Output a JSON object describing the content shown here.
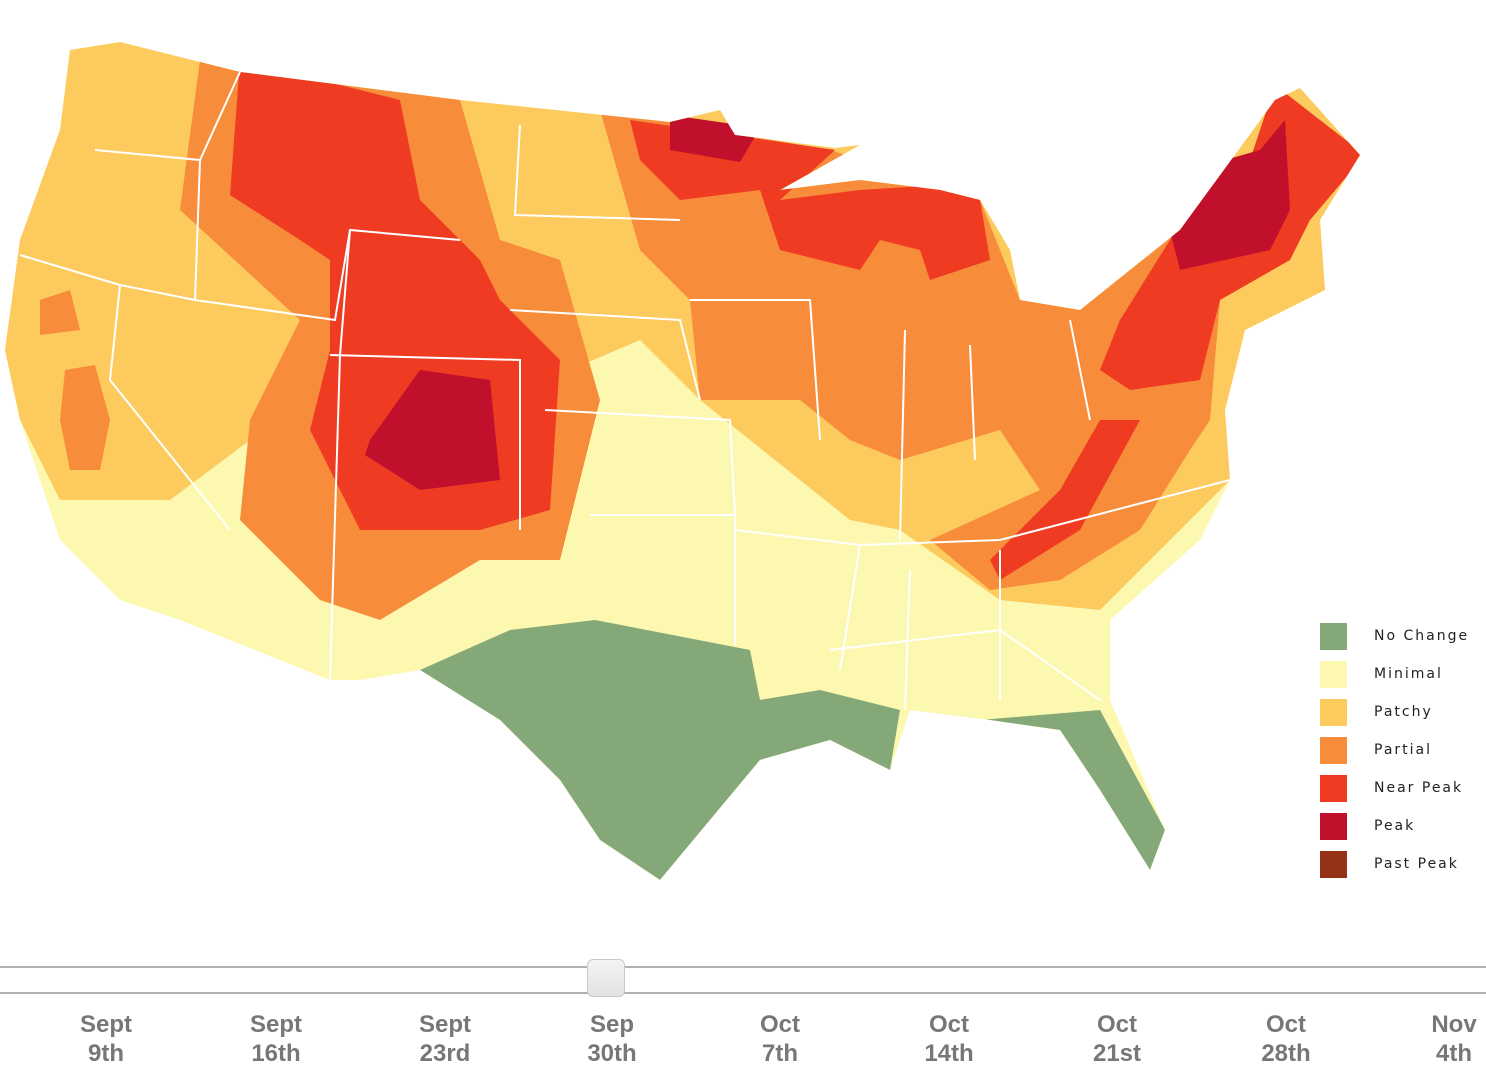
{
  "colors": {
    "no_change": "#84a877",
    "minimal": "#fdf8b0",
    "patchy": "#fdca5e",
    "partial": "#f78c3a",
    "near_peak": "#ee3b22",
    "peak": "#c0102c",
    "past_peak": "#943116"
  },
  "legend": [
    {
      "label": "No Change",
      "color": "#84a877"
    },
    {
      "label": "Minimal",
      "color": "#fdf8b0"
    },
    {
      "label": "Patchy",
      "color": "#fdca5e"
    },
    {
      "label": "Partial",
      "color": "#f78c3a"
    },
    {
      "label": "Near Peak",
      "color": "#ee3b22"
    },
    {
      "label": "Peak",
      "color": "#c0102c"
    },
    {
      "label": "Past Peak",
      "color": "#943116"
    }
  ],
  "slider": {
    "selected_index": 3,
    "ticks": [
      {
        "line1": "Sept",
        "line2": "9th"
      },
      {
        "line1": "Sept",
        "line2": "16th"
      },
      {
        "line1": "Sept",
        "line2": "23rd"
      },
      {
        "line1": "Sep",
        "line2": "30th"
      },
      {
        "line1": "Oct",
        "line2": "7th"
      },
      {
        "line1": "Oct",
        "line2": "14th"
      },
      {
        "line1": "Oct",
        "line2": "21st"
      },
      {
        "line1": "Oct",
        "line2": "28th"
      },
      {
        "line1": "Nov",
        "line2": "4th"
      }
    ]
  }
}
